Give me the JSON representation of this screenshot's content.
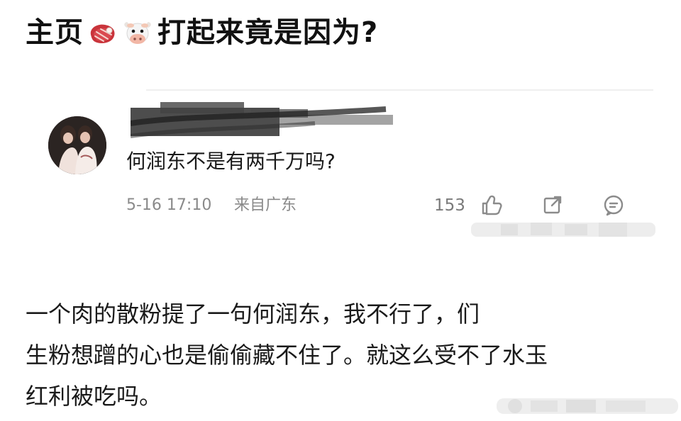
{
  "title": {
    "before": "主页",
    "after": "打起来竟是因为?"
  },
  "comment": {
    "text": "何润东不是有两千万吗?",
    "time": "5-16 17:10",
    "location": "来自广东",
    "likes": "153"
  },
  "body": {
    "line1": "一个肉的散粉提了一句何润东，我不行了，们",
    "line2": "生粉想蹭的心也是偷偷藏不住了。就这么受不了水玉",
    "line3": "红利被吃吗。"
  },
  "icons": {
    "emoji1": "steak-emoji",
    "emoji2": "cow-face-emoji",
    "like": "thumbs-up-icon",
    "share": "share-icon",
    "comment": "comment-icon"
  }
}
